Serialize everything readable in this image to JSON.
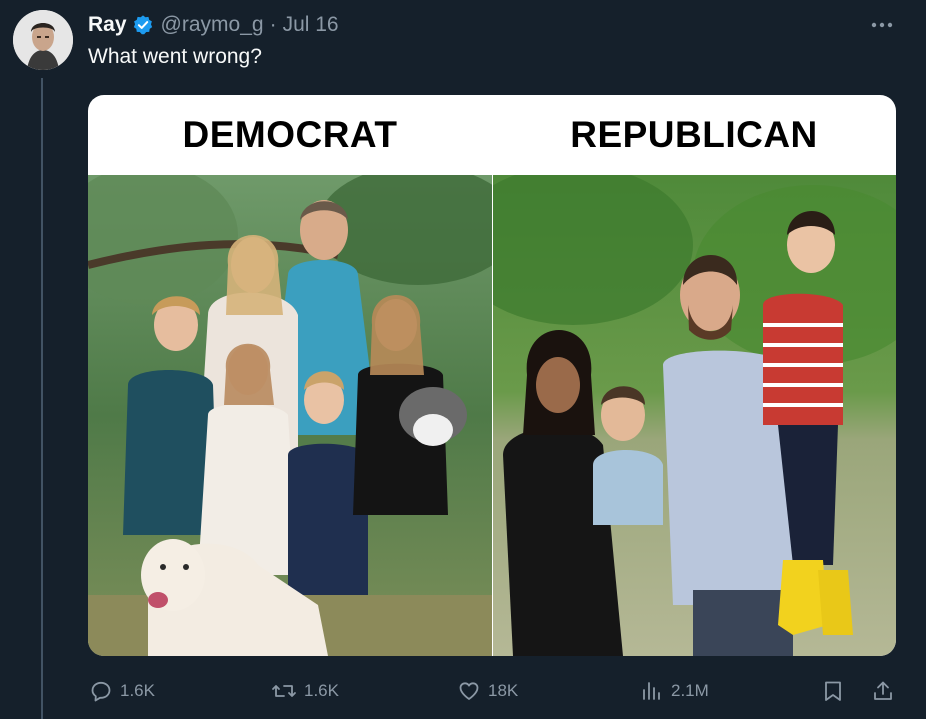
{
  "author": {
    "name": "Ray",
    "handle": "@raymo_g",
    "separator": "·",
    "date": "Jul 16"
  },
  "tweet": {
    "text": "What went wrong?"
  },
  "media": {
    "left_label": "DEMOCRAT",
    "right_label": "REPUBLICAN"
  },
  "actions": {
    "replies": "1.6K",
    "retweets": "1.6K",
    "likes": "18K",
    "views": "2.1M"
  },
  "colors": {
    "background": "#15202b",
    "text": "#f7f9f9",
    "muted": "#8b98a5",
    "verified": "#1d9bf0"
  },
  "icons": [
    "more-icon",
    "verified-icon",
    "reply-icon",
    "retweet-icon",
    "like-icon",
    "views-icon",
    "bookmark-icon",
    "share-icon"
  ]
}
